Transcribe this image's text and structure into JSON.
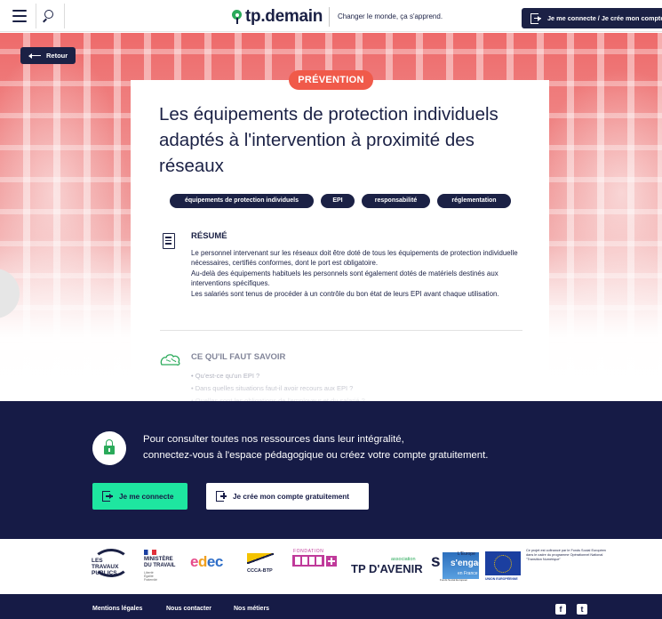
{
  "header": {
    "logo_text": "tp.demain",
    "tagline": "Changer le monde, ça s'apprend.",
    "login_label": "Je me connecte / Je crée mon compte"
  },
  "hero": {
    "back_label": "Retour",
    "category": "PRÉVENTION",
    "title": "Les équipements de protection individuels adaptés à l'intervention à proximité des réseaux",
    "tags": [
      "équipements de protection individuels",
      "EPI",
      "responsabilité",
      "réglementation"
    ]
  },
  "resume": {
    "title": "RÉSUMÉ",
    "lines": [
      "Le personnel intervenant sur les réseaux doit être doté de tous les équipements de protection individuelle nécessaires, certifiés conformes, dont le port est obligatoire.",
      "Au-delà des équipements habituels les personnels sont également dotés de matériels destinés aux interventions spécifiques.",
      "Les salariés sont tenus de procéder à un contrôle du bon état de leurs EPI avant chaque utilisation."
    ]
  },
  "savoir": {
    "title": "CE QU'IL FAUT SAVOIR",
    "items": [
      "• Qu'est-ce qu'un EPI ?",
      "• Dans quelles situations faut-il avoir recours aux EPI ?",
      "• Quelles sont les obligations de l'employeur et du salarié ?"
    ]
  },
  "cta": {
    "line1": "Pour consulter toutes nos ressources dans leur intégralité,",
    "line2": "connectez-vous à l'espace pédagogique ou créez votre compte gratuitement.",
    "login_label": "Je me connecte",
    "signup_label": "Je crée mon compte gratuitement"
  },
  "partners": {
    "ltp": "LES TRAVAUX PUBLICS",
    "ministere": "MINISTÈRE DU TRAVAIL",
    "ministere_sub": "Liberté Égalité Fraternité",
    "edec": "edec",
    "ccca": "CCCA-BTP",
    "btp_title": "FONDATION",
    "tpav_assoc": "association",
    "tpav": "TP D'AVENIR",
    "se_top": "L'Europe",
    "se_mid": "s'engage",
    "se_fr": "en France",
    "se_sub": "Fonds Social Européen",
    "eu_label": "UNION EUROPÉENNE",
    "eu_text": "Ce projet est cofinancé par le Fonds Social Européen dans le cadre du programme Opérationnel National \"Transition Numérique\""
  },
  "footer": {
    "links": [
      "Mentions légales",
      "Nous contacter",
      "Nos métiers"
    ],
    "facebook": "f",
    "twitter": "t"
  },
  "colors": {
    "navy": "#1b2145",
    "cta_bg": "#161b46",
    "accent_red": "#f05a4a",
    "accent_green": "#1ee6a0",
    "logo_green": "#2aaa5a"
  },
  "icons": [
    "hamburger-menu-icon",
    "search-icon",
    "login-icon",
    "back-arrow-icon",
    "document-icon",
    "brain-icon",
    "lock-icon",
    "signup-icon",
    "facebook-icon",
    "twitter-icon"
  ]
}
